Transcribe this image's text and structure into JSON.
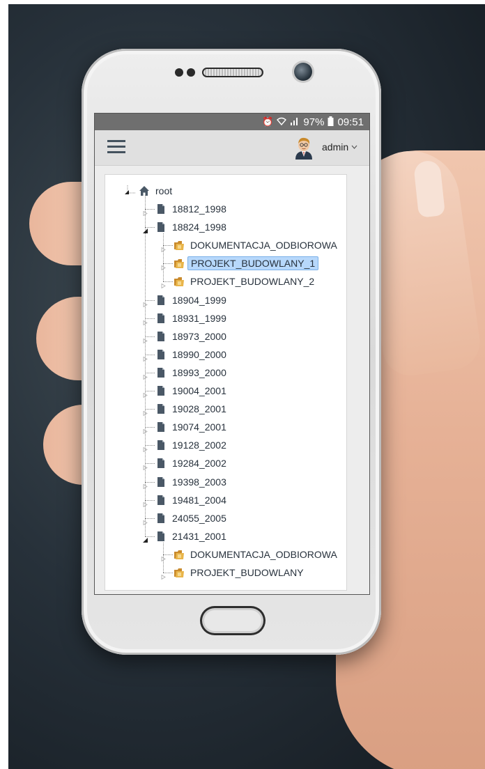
{
  "status": {
    "alarm_icon": "alarm-icon",
    "wifi_icon": "wifi-icon",
    "signal_icon": "signal-icon",
    "battery": "97%",
    "battery_icon": "battery-icon",
    "time": "09:51"
  },
  "header": {
    "menu_icon": "hamburger-menu-icon",
    "user_name": "admin",
    "user_menu_icon": "chevron-down-icon"
  },
  "tree": {
    "root": "root",
    "nodes": [
      {
        "label": "18812_1998",
        "type": "document",
        "level": 1
      },
      {
        "label": "18824_1998",
        "type": "document",
        "level": 1,
        "expanded": true
      },
      {
        "label": "DOKUMENTACJA_ODBIOROWA",
        "type": "folder",
        "level": 2
      },
      {
        "label": "PROJEKT_BUDOWLANY_1",
        "type": "folder",
        "level": 2,
        "selected": true
      },
      {
        "label": "PROJEKT_BUDOWLANY_2",
        "type": "folder",
        "level": 2
      },
      {
        "label": "18904_1999",
        "type": "document",
        "level": 1
      },
      {
        "label": "18931_1999",
        "type": "document",
        "level": 1
      },
      {
        "label": "18973_2000",
        "type": "document",
        "level": 1
      },
      {
        "label": "18990_2000",
        "type": "document",
        "level": 1
      },
      {
        "label": "18993_2000",
        "type": "document",
        "level": 1
      },
      {
        "label": "19004_2001",
        "type": "document",
        "level": 1
      },
      {
        "label": "19028_2001",
        "type": "document",
        "level": 1
      },
      {
        "label": "19074_2001",
        "type": "document",
        "level": 1
      },
      {
        "label": "19128_2002",
        "type": "document",
        "level": 1
      },
      {
        "label": "19284_2002",
        "type": "document",
        "level": 1
      },
      {
        "label": "19398_2003",
        "type": "document",
        "level": 1
      },
      {
        "label": "19481_2004",
        "type": "document",
        "level": 1
      },
      {
        "label": "24055_2005",
        "type": "document",
        "level": 1
      },
      {
        "label": "21431_2001",
        "type": "document",
        "level": 1,
        "expanded": true
      },
      {
        "label": "DOKUMENTACJA_ODBIOROWA",
        "type": "folder",
        "level": 2
      },
      {
        "label": "PROJEKT_BUDOWLANY",
        "type": "folder",
        "level": 2
      }
    ]
  },
  "colors": {
    "statusbar": "#6f6f6f",
    "topbar": "#e0e0e0",
    "selection": "#b7d8fb",
    "icon": "#4a5866",
    "folder": "#e0a93a"
  }
}
